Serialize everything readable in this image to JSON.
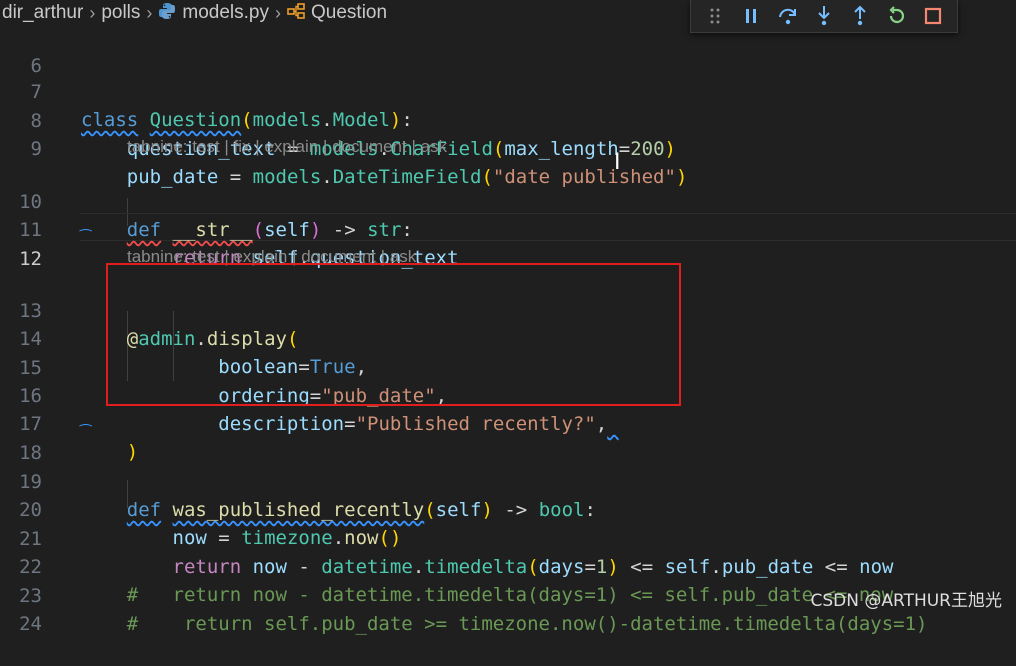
{
  "breadcrumb": {
    "folder1": "dir_arthur",
    "folder2": "polls",
    "file": "models.py",
    "symbol": "Question",
    "separator": ">"
  },
  "debug_toolbar": {
    "icons": [
      "gripper-icon",
      "pause-icon",
      "step-over-icon",
      "step-into-icon",
      "step-out-icon",
      "restart-icon",
      "stop-icon"
    ],
    "colors": {
      "default": "#75beff",
      "restart": "#89d185",
      "stop": "#f48771"
    }
  },
  "editor": {
    "current_line": "12",
    "line_numbers": [
      "6",
      "7",
      "8",
      "9",
      "10",
      "11",
      "12",
      "13",
      "14",
      "15",
      "16",
      "17",
      "18",
      "19",
      "20",
      "21",
      "22",
      "23",
      "24"
    ],
    "lens1": "tabnine: test | fix | explain | document | ask",
    "lens2": "tabnine: test | explain | document | ask",
    "highlight_color": "#e01e1e"
  },
  "watermark": "CSDN @ARTHUR王旭光"
}
